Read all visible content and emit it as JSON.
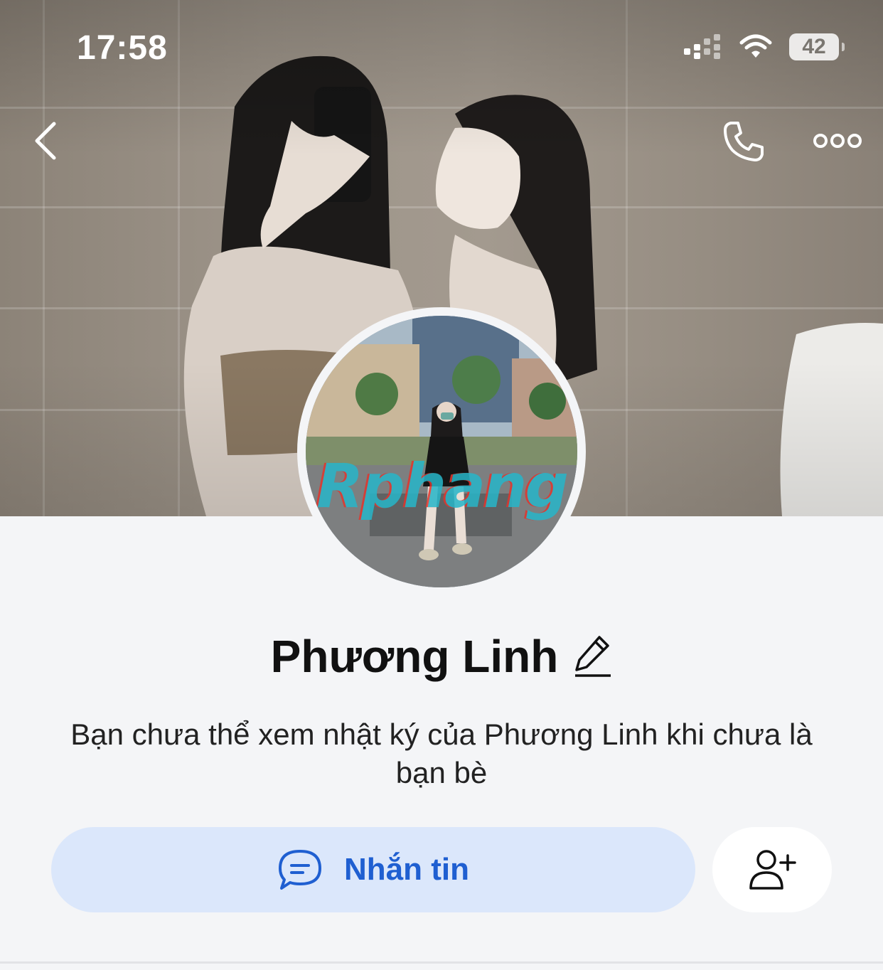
{
  "status_bar": {
    "time": "17:58",
    "battery": "42",
    "icons": [
      "signal-icon",
      "wifi-icon",
      "battery-icon"
    ]
  },
  "header": {
    "back_icon": "chevron-left-icon",
    "call_icon": "phone-icon",
    "more_icon": "more-horizontal-icon"
  },
  "cover": {
    "image": "cover-photo"
  },
  "avatar": {
    "watermark": "Rphang"
  },
  "profile": {
    "name": "Phương Linh",
    "edit_icon": "pencil-icon",
    "description": "Bạn chưa thể xem nhật ký của Phương Linh khi chưa là bạn bè"
  },
  "actions": {
    "message_label": "Nhắn tin",
    "message_icon": "chat-bubble-icon",
    "add_friend_icon": "add-person-icon"
  },
  "colors": {
    "accent": "#1f5fd1",
    "message_button_bg": "#dbe7fb",
    "page_bg": "#f4f5f7"
  }
}
